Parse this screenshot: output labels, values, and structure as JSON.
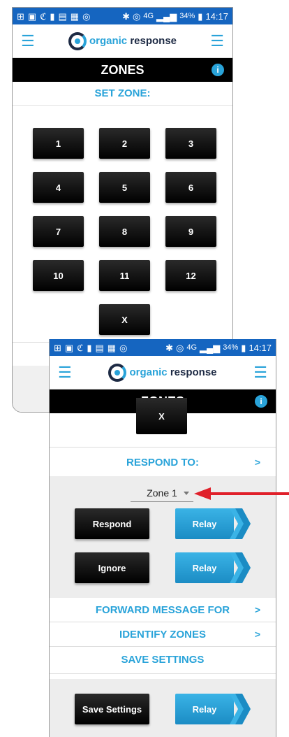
{
  "status_bar": {
    "battery": "34%",
    "network": "4G",
    "time": "14:17"
  },
  "header": {
    "logo_word1": "organic",
    "logo_word2": "response"
  },
  "screen1": {
    "title": "ZONES",
    "info": "i",
    "set_zone_label": "SET ZONE:",
    "keys": [
      "1",
      "2",
      "3",
      "4",
      "5",
      "6",
      "7",
      "8",
      "9",
      "10",
      "11",
      "12"
    ],
    "x_key": "X"
  },
  "screen2": {
    "title": "ZONES",
    "info": "i",
    "x_key": "X",
    "respond_to": "RESPOND TO:",
    "zone_select": "Zone 1",
    "respond_button": "Respond",
    "ignore_button": "Ignore",
    "relay_label": "Relay",
    "forward_message": "FORWARD MESSAGE FOR",
    "identify_zones": "IDENTIFY ZONES",
    "save_settings_heading": "SAVE SETTINGS",
    "save_settings_button": "Save Settings",
    "chevron": ">"
  },
  "colors": {
    "accent": "#29a3d9",
    "status_bar": "#1565c0",
    "title_bar": "#000000",
    "annotation_arrow": "#e0202a"
  }
}
